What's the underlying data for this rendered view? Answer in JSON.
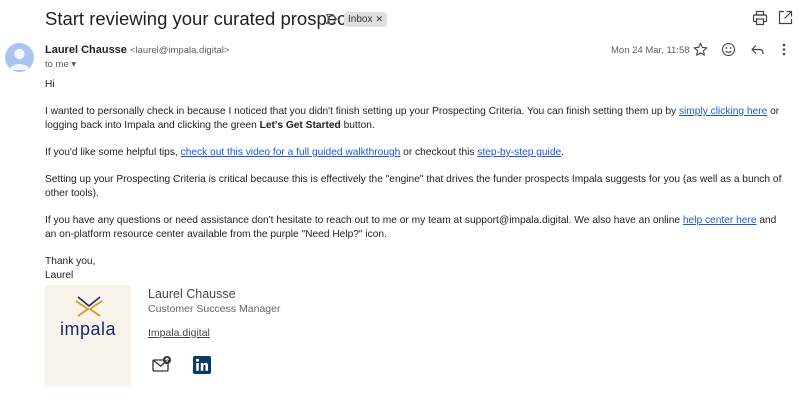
{
  "email": {
    "subject": "Start reviewing your curated prospects",
    "label_chip": "Inbox",
    "sender_name": "Laurel Chausse",
    "sender_email": "<laurel@impala.digital>",
    "to_line": "to me",
    "date": "Mon 24 Mar, 11:58"
  },
  "body": {
    "greeting": "Hi",
    "p1_a": "I wanted to personally check in because I noticed that you didn't finish setting up your Prospecting Criteria. You can finish setting them up by ",
    "p1_link": "simply clicking here",
    "p1_b": " or logging back into Impala and clicking the green ",
    "p1_bold": "Let's Get Started",
    "p1_c": " button.",
    "p2_a": "If you'd like some helpful tips, ",
    "p2_link1": "check out this video for a full guided walkthrough",
    "p2_b": " or checkout this ",
    "p2_link2": "step-by-step guide",
    "p2_c": ".",
    "p3": "Setting up your Prospecting Criteria is critical because this is effectively the \"engine\" that drives the funder prospects Impala suggests for you (as well as a bunch of other tools).",
    "p4_a": "If you have any questions or need assistance don't hesitate to reach out to me or my team at support@impala.digital. We also have an online ",
    "p4_link": "help center here",
    "p4_b": " and an on-platform resource center available from the purple \"Need Help?\" icon.",
    "signoff": "Thank you,",
    "signoff_name": "Laurel"
  },
  "signature": {
    "logo_text": "impala",
    "name": "Laurel Chausse",
    "title": "Customer Success Manager",
    "website": "Impala.digital"
  },
  "icons": {
    "top": [
      "label-arrow-icon",
      "print-icon",
      "open-new-window-icon"
    ],
    "header": [
      "star-icon",
      "emoji-icon",
      "reply-icon",
      "more-vert-icon"
    ],
    "signature": [
      "email-icon",
      "linkedin-icon"
    ]
  },
  "colors": {
    "link": "#1a59d6",
    "logo_bg": "#f8f3ea",
    "logo_text": "#1b2a6b",
    "logo_mark": "#d4a01c",
    "linkedin": "#0a3a66",
    "avatar": "#a9c4ef"
  }
}
